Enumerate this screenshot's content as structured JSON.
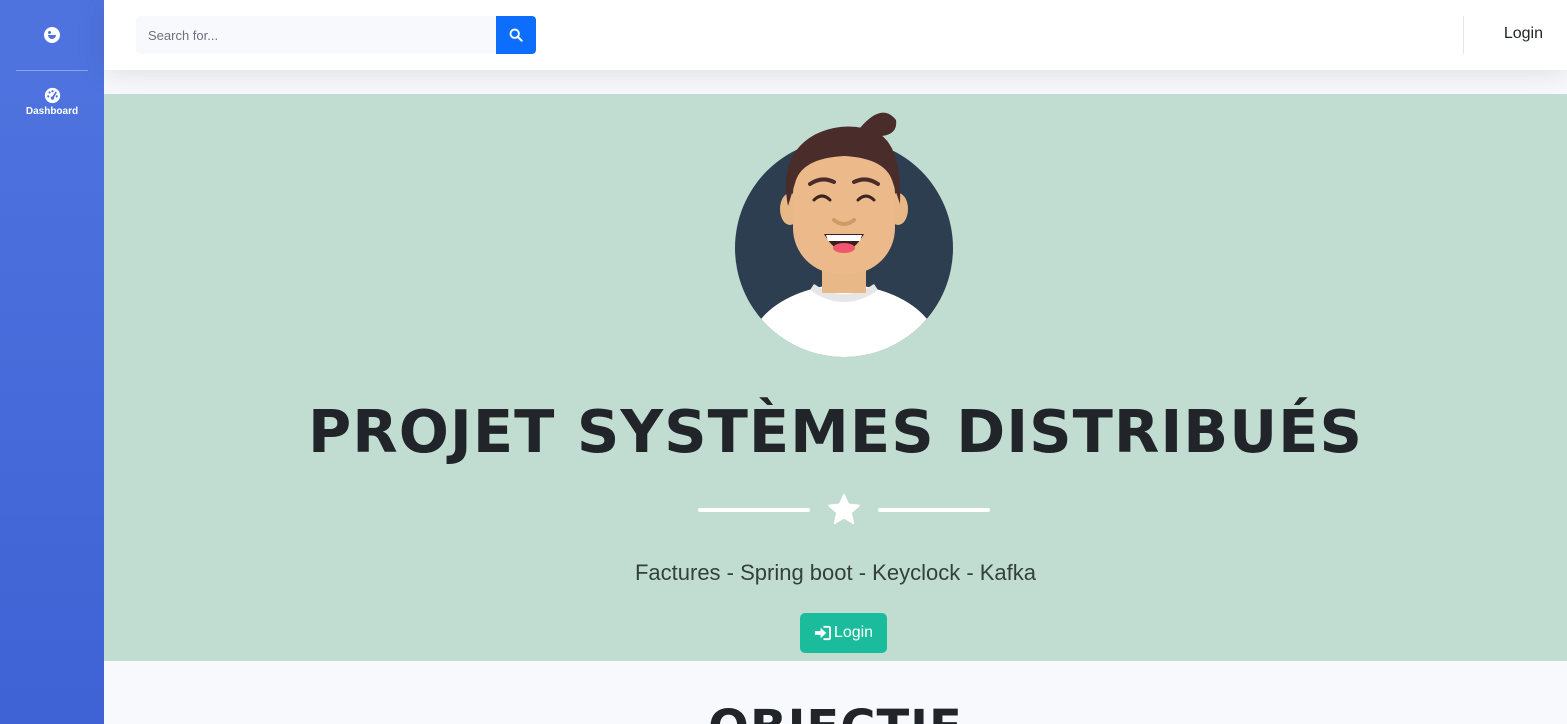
{
  "sidebar": {
    "brand_icon": "smile-icon",
    "items": [
      {
        "label": "Dashboard",
        "icon": "tachometer-icon"
      }
    ]
  },
  "topbar": {
    "search": {
      "placeholder": "Search for...",
      "value": "",
      "button_icon": "search-icon"
    },
    "login_label": "Login"
  },
  "masthead": {
    "title": "PROJET SYSTÈMES DISTRIBUÉS",
    "divider_icon": "star-icon",
    "subtitle": "Factures - Spring boot - Keyclock - Kafka",
    "login_button": "Login",
    "login_button_icon": "sign-in-icon"
  },
  "next_section": {
    "title": "OBJECTIF"
  },
  "colors": {
    "sidebar": "#4e73df",
    "masthead_bg": "#c1ddd2",
    "accent_button": "#1abc9c",
    "search_button": "#0d6efd"
  }
}
